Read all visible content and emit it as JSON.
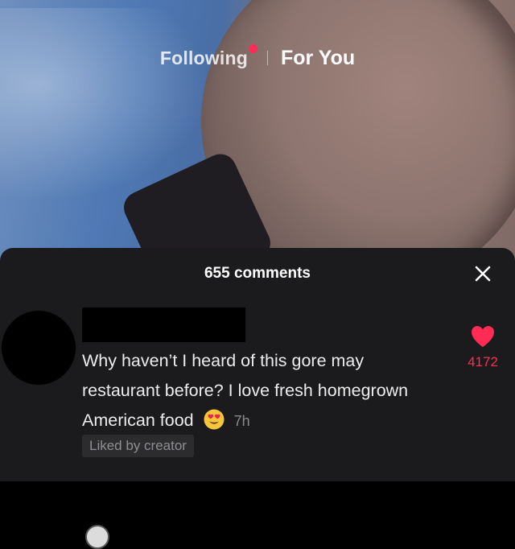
{
  "nav": {
    "following_label": "Following",
    "for_you_label": "For You",
    "live_dot_color": "#fe2c55"
  },
  "comments_sheet": {
    "count_label": "655 comments",
    "close_icon": "close-icon",
    "comments": [
      {
        "username": "",
        "text": "Why haven’t I heard of this gore may restaurant before? I love fresh homegrown American food",
        "emoji_icon": "heart-eyes-emoji-icon",
        "timestamp": "7h",
        "liked_badge": "Liked by creator",
        "likes": "4172",
        "heart_icon": "heart-icon",
        "heart_color": "#fe2c55"
      }
    ]
  }
}
